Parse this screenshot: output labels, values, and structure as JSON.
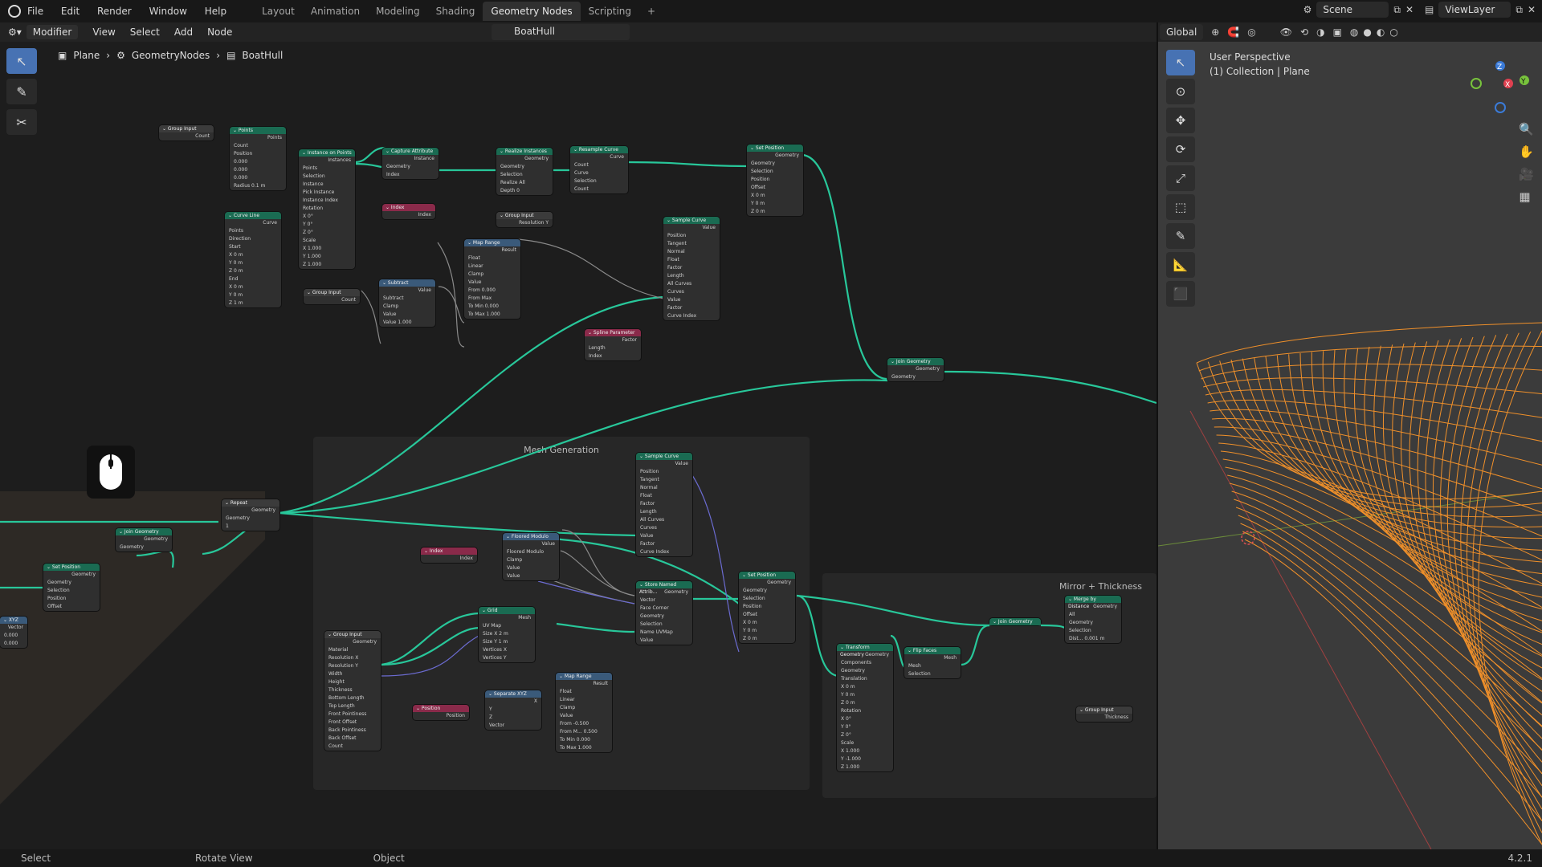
{
  "menu": [
    "File",
    "Edit",
    "Render",
    "Window",
    "Help"
  ],
  "workspaces": [
    {
      "label": "Layout",
      "active": false
    },
    {
      "label": "Animation",
      "active": false
    },
    {
      "label": "Modeling",
      "active": false
    },
    {
      "label": "Shading",
      "active": false
    },
    {
      "label": "Geometry Nodes",
      "active": true
    },
    {
      "label": "Scripting",
      "active": false
    },
    {
      "label": "+",
      "active": false
    }
  ],
  "top_right": {
    "scene": "Scene",
    "view_layer": "ViewLayer"
  },
  "node_editor": {
    "mode": "Modifier",
    "menus": [
      "View",
      "Select",
      "Add",
      "Node"
    ],
    "tree_name": "BoatHull",
    "breadcrumb": [
      "Plane",
      "GeometryNodes",
      "BoatHull"
    ],
    "frames": [
      {
        "title": "Mesh Generation"
      },
      {
        "title": "Mirror + Thickness"
      }
    ],
    "nodes": {
      "group_input_1": {
        "title": "Group Input",
        "rows": [
          "Count"
        ]
      },
      "points": {
        "title": "Points",
        "rows": [
          "Points",
          "Count",
          "Position",
          "0.000",
          "0.000",
          "0.000",
          "Radius   0.1 m"
        ]
      },
      "instance_on_points": {
        "title": "Instance on Points",
        "rows": [
          "Instances",
          "Points",
          "Selection",
          "Instance",
          "Pick Instance",
          "Instance Index",
          "Rotation",
          "X   0°",
          "Y   0°",
          "Z   0°",
          "Scale",
          "X   1.000",
          "Y   1.000",
          "Z   1.000"
        ]
      },
      "capture_attribute": {
        "title": "Capture Attribute",
        "rows": [
          "Instance",
          "Geometry",
          "Index"
        ]
      },
      "index_1": {
        "title": "Index",
        "rows": [
          "Index"
        ]
      },
      "realize_instances": {
        "title": "Realize Instances",
        "rows": [
          "Geometry",
          "Geometry",
          "Selection",
          "Realize All",
          "Depth   0"
        ]
      },
      "resample_curve": {
        "title": "Resample Curve",
        "rows": [
          "Curve",
          "Count",
          "Curve",
          "Selection",
          "Count"
        ]
      },
      "group_input_2": {
        "title": "Group Input",
        "rows": [
          "Resolution Y"
        ]
      },
      "set_position_1": {
        "title": "Set Position",
        "rows": [
          "Geometry",
          "Geometry",
          "Selection",
          "Position",
          "Offset",
          "X   0 m",
          "Y   0 m",
          "Z   0 m"
        ]
      },
      "curve_line": {
        "title": "Curve Line",
        "rows": [
          "Curve",
          "Points",
          "Direction",
          "Start",
          "X   0 m",
          "Y   0 m",
          "Z   0 m",
          "End",
          "X   0 m",
          "Y   0 m",
          "Z   1 m"
        ]
      },
      "group_input_3": {
        "title": "Group Input",
        "rows": [
          "Count"
        ]
      },
      "subtract": {
        "title": "Subtract",
        "rows": [
          "Value",
          "Subtract",
          "Clamp",
          "Value",
          "Value   1.000"
        ]
      },
      "map_range_1": {
        "title": "Map Range",
        "rows": [
          "Result",
          "Float",
          "Linear",
          "Clamp",
          "Value",
          "From   0.000",
          "From Max",
          "To Min   0.000",
          "To Max   1.000"
        ]
      },
      "sample_curve_1": {
        "title": "Sample Curve",
        "rows": [
          "Value",
          "Position",
          "Tangent",
          "Normal",
          "Float",
          "Factor",
          "Length",
          "All Curves",
          "Curves",
          "Value",
          "Factor",
          "Curve Index"
        ]
      },
      "spline_parameter": {
        "title": "Spline Parameter",
        "rows": [
          "Factor",
          "Length",
          "Index"
        ]
      },
      "join_geometry_1": {
        "title": "Join Geometry",
        "rows": [
          "Geometry",
          "Geometry"
        ]
      },
      "repeat": {
        "title": "Repeat",
        "rows": [
          "Geometry",
          "Geometry",
          "1"
        ]
      },
      "join_geometry_2": {
        "title": "Join Geometry",
        "rows": [
          "Geometry",
          "Geometry"
        ]
      },
      "set_position_2": {
        "title": "Set Position",
        "rows": [
          "Geometry",
          "Geometry",
          "Selection",
          "Position",
          "Offset"
        ]
      },
      "combine_xyz": {
        "title": "XYZ",
        "rows": [
          "Vector",
          "0.000",
          "0.000"
        ]
      },
      "sample_curve_2": {
        "title": "Sample Curve",
        "rows": [
          "Value",
          "Position",
          "Tangent",
          "Normal",
          "Float",
          "Factor",
          "Length",
          "All Curves",
          "Curves",
          "Value",
          "Factor",
          "Curve Index"
        ]
      },
      "index_2": {
        "title": "Index",
        "rows": [
          "Index"
        ]
      },
      "floored_modulo": {
        "title": "Floored Modulo",
        "rows": [
          "Value",
          "Floored Modulo",
          "Clamp",
          "Value",
          "Value"
        ]
      },
      "grid": {
        "title": "Grid",
        "rows": [
          "Mesh",
          "UV Map",
          "Size X   2 m",
          "Size Y   1 m",
          "Vertices X",
          "Vertices Y"
        ]
      },
      "store_named_attribute": {
        "title": "Store Named Attrib...",
        "rows": [
          "Geometry",
          "Vector",
          "Face Corner",
          "Geometry",
          "Selection",
          "Name   UVMap",
          "Value"
        ]
      },
      "set_position_3": {
        "title": "Set Position",
        "rows": [
          "Geometry",
          "Geometry",
          "Selection",
          "Position",
          "Offset",
          "X   0 m",
          "Y   0 m",
          "Z   0 m"
        ]
      },
      "group_input_4": {
        "title": "Group Input",
        "rows": [
          "Geometry",
          "Material",
          "Resolution X",
          "Resolution Y",
          "Width",
          "Height",
          "Thickness",
          "Bottom Length",
          "Top Length",
          "Front Pointiness",
          "Front Offset",
          "Back Pointiness",
          "Back Offset",
          "Count"
        ]
      },
      "position": {
        "title": "Position",
        "rows": [
          "Position"
        ]
      },
      "separate_xyz": {
        "title": "Separate XYZ",
        "rows": [
          "X",
          "Y",
          "Z",
          "Vector"
        ]
      },
      "map_range_2": {
        "title": "Map Range",
        "rows": [
          "Result",
          "Float",
          "Linear",
          "Clamp",
          "Value",
          "From   -0.500",
          "From M...   0.500",
          "To Min   0.000",
          "To Max   1.000"
        ]
      },
      "transform_geometry": {
        "title": "Transform Geometry",
        "rows": [
          "Geometry",
          "Components",
          "Geometry",
          "Translation",
          "X   0 m",
          "Y   0 m",
          "Z   0 m",
          "Rotation",
          "X   0°",
          "Y   0°",
          "Z   0°",
          "Scale",
          "X   1.000",
          "Y   -1.000",
          "Z   1.000"
        ]
      },
      "flip_faces": {
        "title": "Flip Faces",
        "rows": [
          "Mesh",
          "Mesh",
          "Selection"
        ]
      },
      "join_geometry_3": {
        "title": "Join Geometry",
        "rows": []
      },
      "merge_by_distance": {
        "title": "Merge by Distance",
        "rows": [
          "Geometry",
          "All",
          "Geometry",
          "Selection",
          "Dist...   0.001 m"
        ]
      },
      "group_input_5": {
        "title": "Group Input",
        "rows": [
          "Thickness"
        ]
      }
    }
  },
  "viewport": {
    "view_name": "User Perspective",
    "collection": "(1) Collection | Plane",
    "orientation": "Global"
  },
  "status": {
    "select": "Select",
    "rotate": "Rotate View",
    "object": "Object",
    "version": "4.2.1"
  },
  "colors": {
    "geometry_wire": "#28c79a",
    "accent": "#4772b3",
    "mesh_wire": "#f0902a"
  }
}
